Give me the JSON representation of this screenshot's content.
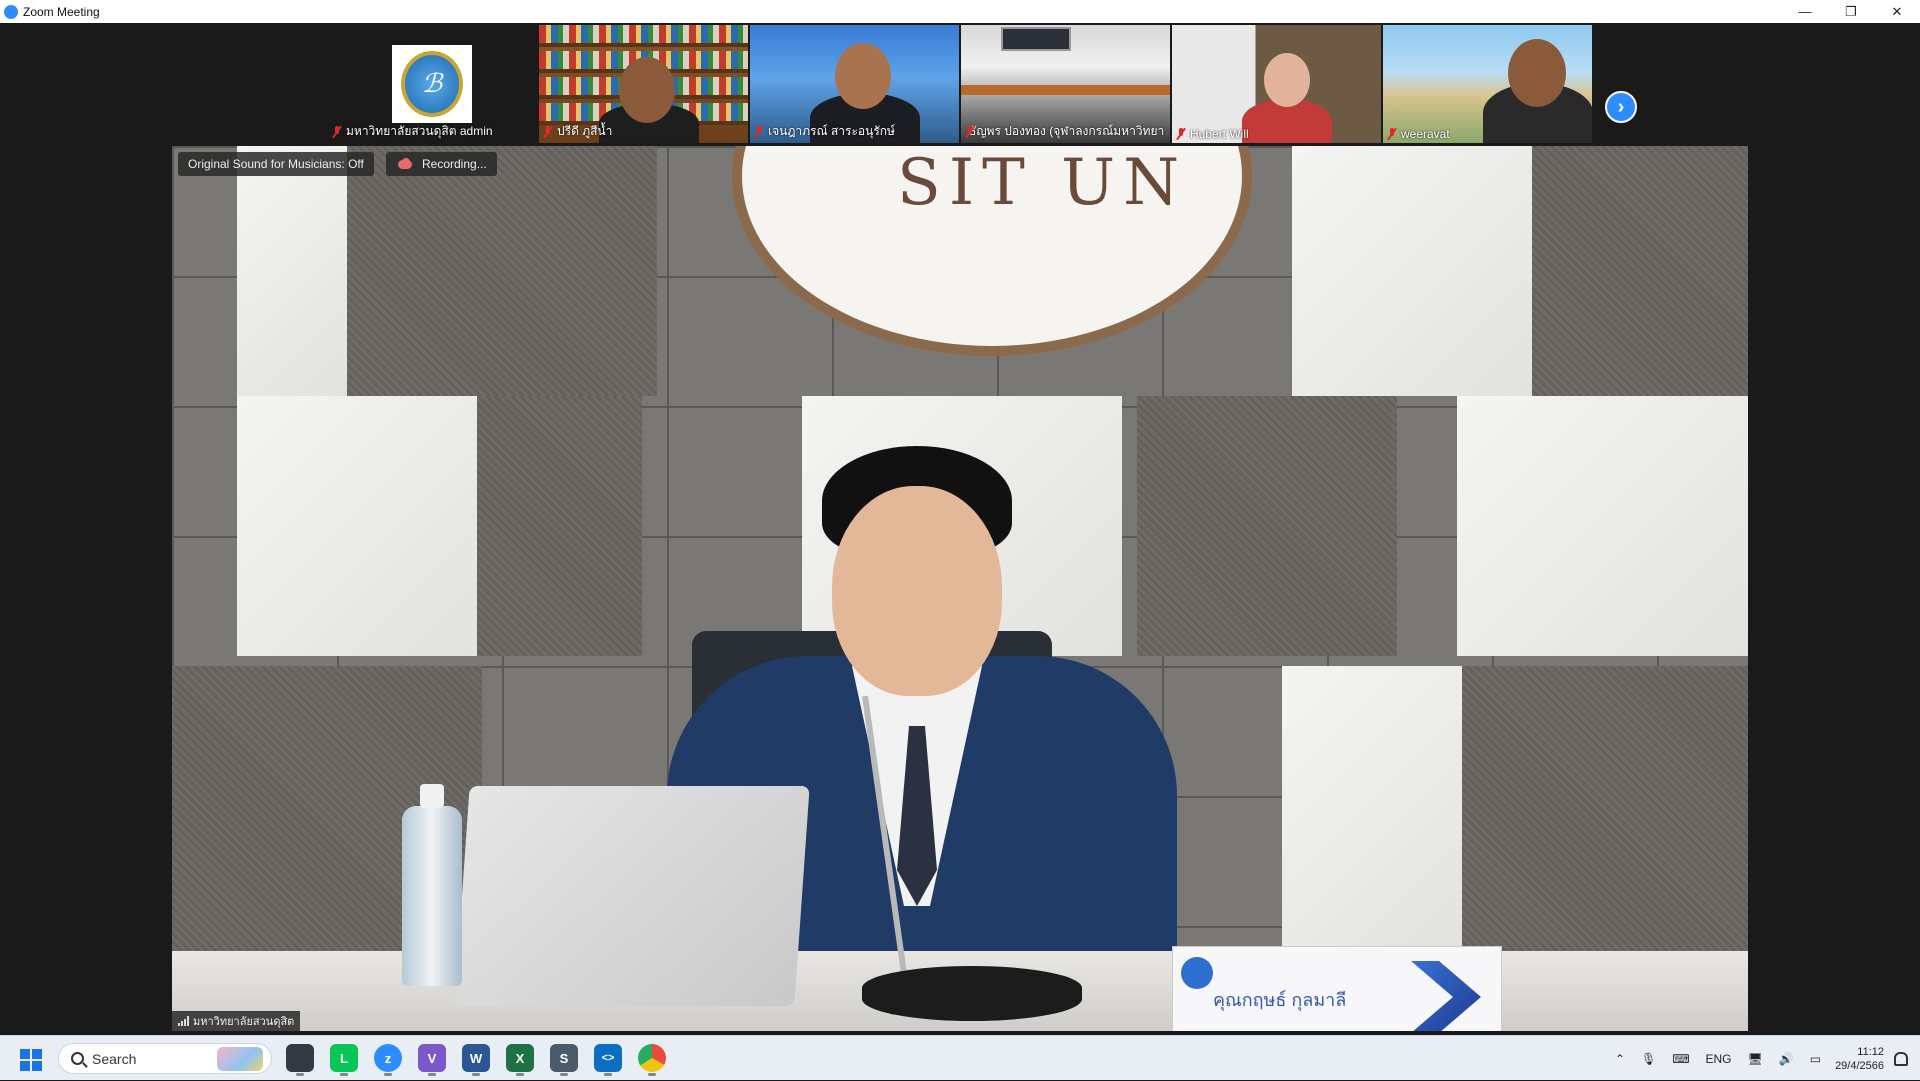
{
  "window": {
    "title": "Zoom Meeting",
    "controls": {
      "minimize": "—",
      "restore": "❐",
      "close": "✕"
    }
  },
  "gallery": {
    "participants": [
      {
        "name": "มหาวิทยาลัยสวนดุสิต admin",
        "muted": true,
        "view": "logo"
      },
      {
        "name": "ปรีดี ภูสีน้ำ",
        "muted": true,
        "view": "video"
      },
      {
        "name": "เจนฎาภรณ์ สาระอนุรักษ์",
        "muted": true,
        "view": "video"
      },
      {
        "name": "ธัญพร ปองทอง (จุฬาลงกรณ์มหาวิทยา...",
        "muted": true,
        "view": "video"
      },
      {
        "name": "Hubert Will",
        "muted": true,
        "view": "video"
      },
      {
        "name": "weeravat",
        "muted": true,
        "view": "video"
      }
    ],
    "next_page_icon": "chevron-right-icon"
  },
  "main_video": {
    "status_pills": {
      "original_sound": "Original Sound for Musicians: Off",
      "recording": "Recording..."
    },
    "speaker_name": "มหาวิทยาลัยสวนดุสิต",
    "emblem_text": "SIT UN",
    "nameplate_text": "คุณกฤษธ์ กุลมาลี"
  },
  "taskbar": {
    "search_placeholder": "Search",
    "apps": [
      {
        "name": "file-explorer",
        "label": ""
      },
      {
        "name": "line",
        "label": "L"
      },
      {
        "name": "zoom",
        "label": "z"
      },
      {
        "name": "visual-studio",
        "label": "V"
      },
      {
        "name": "word",
        "label": "W"
      },
      {
        "name": "excel",
        "label": "X"
      },
      {
        "name": "snipping-tool",
        "label": "S"
      },
      {
        "name": "vscode",
        "label": "<>"
      },
      {
        "name": "chrome",
        "label": ""
      }
    ],
    "tray": {
      "language": "ENG",
      "time": "11:12",
      "date": "29/4/2566"
    }
  },
  "colors": {
    "zoom_blue": "#2d8cff",
    "muted_red": "#e02828",
    "meeting_bg": "#1a1a1a",
    "taskbar_bg": "#e9eef5"
  }
}
